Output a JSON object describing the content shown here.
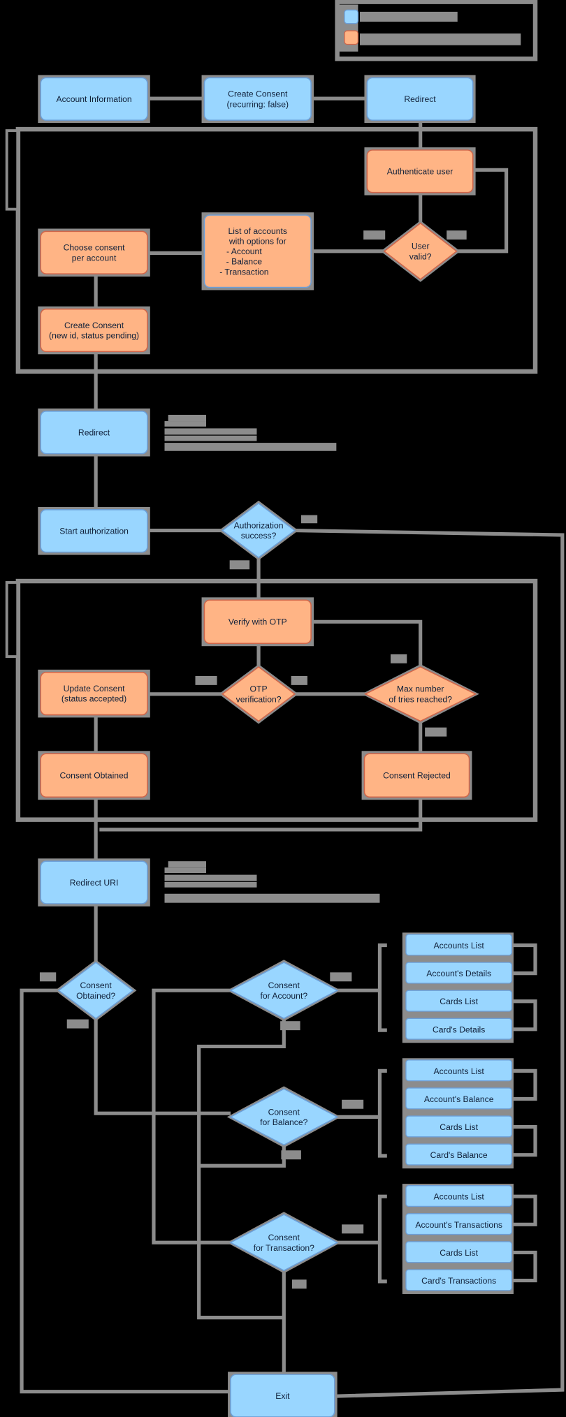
{
  "colors": {
    "background": "#000000",
    "connector": "#8c8c8c",
    "blue_fill": "#99d6ff",
    "blue_stroke": "#6c9fd8",
    "orange_fill": "#ffb485",
    "orange_stroke": "#d0664a"
  },
  "legend": {
    "items": [
      {
        "swatch": "blue",
        "icon": "blue-square-icon"
      },
      {
        "swatch": "orange",
        "icon": "orange-square-icon"
      }
    ]
  },
  "nodes": [
    {
      "id": "account_info",
      "kind": "process",
      "color": "blue",
      "lines": [
        "Account Information"
      ]
    },
    {
      "id": "create_consent_1",
      "kind": "process",
      "color": "blue",
      "lines": [
        "Create Consent",
        "(recurring: false)"
      ]
    },
    {
      "id": "redirect_1",
      "kind": "process",
      "color": "blue",
      "lines": [
        "Redirect"
      ]
    },
    {
      "id": "authenticate",
      "kind": "process",
      "color": "orange",
      "lines": [
        "Authenticate user"
      ]
    },
    {
      "id": "user_valid",
      "kind": "decision",
      "color": "orange",
      "lines": [
        "User",
        "valid?"
      ]
    },
    {
      "id": "list_accounts",
      "kind": "process",
      "color": "orange",
      "lines": [
        "List of accounts",
        "with options for",
        "- Account",
        "- Balance",
        "- Transaction"
      ]
    },
    {
      "id": "choose_consent",
      "kind": "process",
      "color": "orange",
      "lines": [
        "Choose consent",
        "per account"
      ]
    },
    {
      "id": "create_consent_2",
      "kind": "process",
      "color": "orange",
      "lines": [
        "Create Consent",
        "(new id, status pending)"
      ]
    },
    {
      "id": "redirect_2",
      "kind": "process",
      "color": "blue",
      "lines": [
        "Redirect"
      ]
    },
    {
      "id": "start_auth",
      "kind": "process",
      "color": "blue",
      "lines": [
        "Start authorization"
      ]
    },
    {
      "id": "auth_success",
      "kind": "decision",
      "color": "blue",
      "lines": [
        "Authorization",
        "success?"
      ]
    },
    {
      "id": "verify_otp",
      "kind": "process",
      "color": "orange",
      "lines": [
        "Verify with OTP"
      ]
    },
    {
      "id": "otp_verification",
      "kind": "decision",
      "color": "orange",
      "lines": [
        "OTP",
        "verification?"
      ]
    },
    {
      "id": "max_tries",
      "kind": "decision",
      "color": "orange",
      "lines": [
        "Max number",
        "of tries reached?"
      ]
    },
    {
      "id": "update_consent",
      "kind": "process",
      "color": "orange",
      "lines": [
        "Update Consent",
        "(status accepted)"
      ]
    },
    {
      "id": "consent_obtained",
      "kind": "process",
      "color": "orange",
      "lines": [
        "Consent Obtained"
      ]
    },
    {
      "id": "consent_rejected",
      "kind": "process",
      "color": "orange",
      "lines": [
        "Consent Rejected"
      ]
    },
    {
      "id": "redirect_uri",
      "kind": "process",
      "color": "blue",
      "lines": [
        "Redirect URI"
      ]
    },
    {
      "id": "consent_obtained_q",
      "kind": "decision",
      "color": "blue",
      "lines": [
        "Consent",
        "Obtained?"
      ]
    },
    {
      "id": "consent_account_q",
      "kind": "decision",
      "color": "blue",
      "lines": [
        "Consent",
        "for Account?"
      ]
    },
    {
      "id": "consent_balance_q",
      "kind": "decision",
      "color": "blue",
      "lines": [
        "Consent",
        "for Balance?"
      ]
    },
    {
      "id": "consent_transaction_q",
      "kind": "decision",
      "color": "blue",
      "lines": [
        "Consent",
        "for Transaction?"
      ]
    },
    {
      "id": "exit",
      "kind": "process",
      "color": "blue",
      "lines": [
        "Exit"
      ]
    }
  ],
  "endpoint_groups": [
    [
      "Accounts List",
      "Account's Details",
      "Cards List",
      "Card's Details"
    ],
    [
      "Accounts List",
      "Account's Balance",
      "Cards List",
      "Card's Balance"
    ],
    [
      "Accounts List",
      "Account's Transactions",
      "Cards List",
      "Card's Transactions"
    ]
  ]
}
